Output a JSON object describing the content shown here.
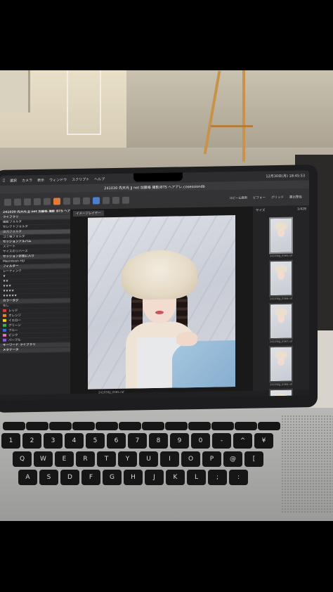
{
  "menubar": {
    "items": [
      "選択",
      "カメラ",
      "表示",
      "ウィンドウ",
      "スクリプト",
      "ヘルプ"
    ],
    "clock": "12月30日(月) 18:45:53"
  },
  "window": {
    "title": "241030 先天光 JJ net 加藤格 撮影/BTS ヘアアレ.cosessiondb"
  },
  "toolbar": {
    "labels": [
      "コピー&適用",
      "ビフォー",
      "グリッド",
      "露出警告"
    ]
  },
  "viewer": {
    "tab": "イメージレイヤー",
    "status": "241030JJ_0365.raf",
    "zoom": "1/428",
    "sort": "サイズ"
  },
  "sidebar": {
    "items": [
      {
        "label": "241030 先天光 JJ net 加藤格 撮影 BTS ヘア",
        "type": "hdr"
      },
      {
        "label": "ライブラリ",
        "type": "hdr"
      },
      {
        "label": "撮影フォルダ",
        "type": "row"
      },
      {
        "label": "セレクトフォルダ",
        "type": "row"
      },
      {
        "label": "出力フォルダ",
        "type": "sel"
      },
      {
        "label": "ゴミ箱フォルダ",
        "type": "row"
      },
      {
        "label": "セッションアルバム",
        "type": "hdr"
      },
      {
        "label": "スマート",
        "type": "row"
      },
      {
        "label": "サイズのリバース",
        "type": "row"
      },
      {
        "label": "セッションお気に入り",
        "type": "hdr"
      },
      {
        "label": "Macintosh HD",
        "type": "row"
      },
      {
        "label": "フィルター",
        "type": "hdr"
      },
      {
        "label": "レーティング",
        "type": "row"
      },
      {
        "label": "★",
        "type": "row"
      },
      {
        "label": "★★",
        "type": "row"
      },
      {
        "label": "★★★",
        "type": "row"
      },
      {
        "label": "★★★★",
        "type": "row"
      },
      {
        "label": "★★★★★",
        "type": "row"
      },
      {
        "label": "カラータグ",
        "type": "hdr"
      },
      {
        "label": "なし",
        "type": "row"
      },
      {
        "label": "レッド",
        "type": "row",
        "color": "#d93a3a"
      },
      {
        "label": "オレンジ",
        "type": "row",
        "color": "#e48a2e"
      },
      {
        "label": "イエロー",
        "type": "row",
        "color": "#e6cf33"
      },
      {
        "label": "グリーン",
        "type": "row",
        "color": "#3fae4f"
      },
      {
        "label": "ブルー",
        "type": "row",
        "color": "#3a6fd9"
      },
      {
        "label": "ピンク",
        "type": "row",
        "color": "#e079b4"
      },
      {
        "label": "パープル",
        "type": "row",
        "color": "#8a5ad0"
      },
      {
        "label": "キーワード ライブラリ",
        "type": "hdr"
      },
      {
        "label": "メタデータ",
        "type": "hdr"
      }
    ]
  },
  "thumbnails": [
    {
      "label": "241030JJ_0365.raf"
    },
    {
      "label": "241030JJ_0366.raf"
    },
    {
      "label": "241030JJ_0367.raf"
    },
    {
      "label": "241030JJ_0368.raf"
    },
    {
      "label": "241030JJ_0369.raf"
    }
  ],
  "keyboard": {
    "row1": [
      "1",
      "2",
      "3",
      "4",
      "5",
      "6",
      "7",
      "8",
      "9",
      "0",
      "-",
      "^",
      "¥"
    ],
    "row2": [
      "Q",
      "W",
      "E",
      "R",
      "T",
      "Y",
      "U",
      "I",
      "O",
      "P",
      "@",
      "["
    ],
    "row3": [
      "A",
      "S",
      "D",
      "F",
      "G",
      "H",
      "J",
      "K",
      "L",
      ";",
      ":"
    ]
  },
  "colors": {
    "accent": "#e07b3a",
    "screen_bg": "#202022"
  }
}
